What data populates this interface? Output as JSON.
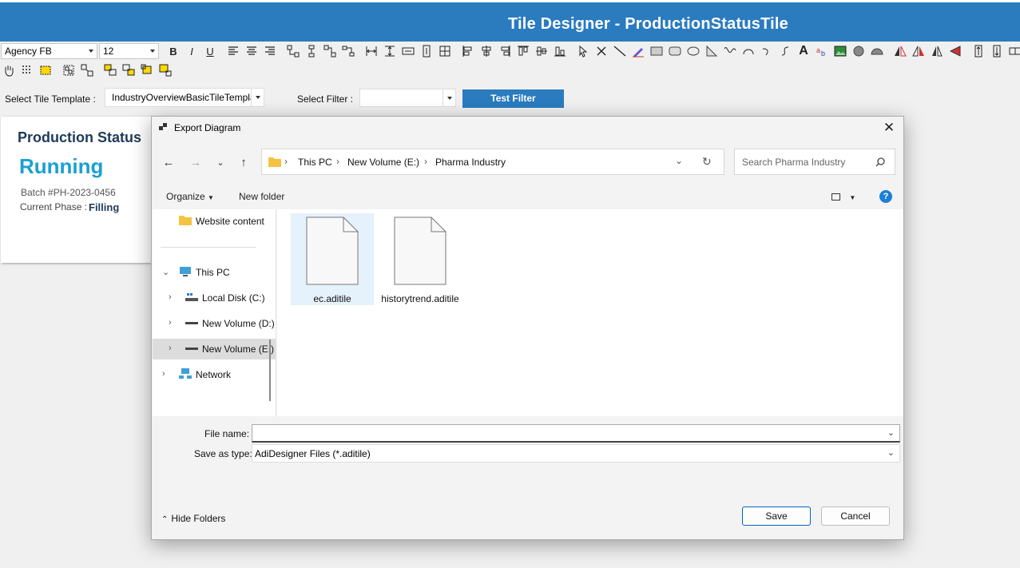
{
  "app": {
    "title": "Tile Designer - ProductionStatusTile"
  },
  "toolbar": {
    "font_family": "Agency FB",
    "font_size": "12",
    "bold_label": "B",
    "italic_label": "I",
    "underline_label": "U",
    "text_tool_label": "A"
  },
  "template_bar": {
    "template_label": "Select Tile Template :",
    "template_value": "IndustryOverviewBasicTileTemplate",
    "filter_label": "Select Filter :",
    "filter_value": "",
    "test_button": "Test Filter"
  },
  "tile": {
    "title": "Production Status",
    "status": "Running",
    "batch": "Batch #PH-2023-0456",
    "phase_label": "Current Phase :",
    "phase_value": "Filling"
  },
  "dialog": {
    "title": "Export Diagram",
    "address": [
      "This PC",
      "New Volume (E:)",
      "Pharma Industry"
    ],
    "search_placeholder": "Search Pharma Industry",
    "organize_label": "Organize",
    "new_folder_label": "New folder",
    "nav_items": [
      "Website content",
      "This PC",
      "Local Disk (C:)",
      "New Volume (D:)",
      "New Volume (E:)",
      "Network"
    ],
    "files": [
      "ec.aditile",
      "historytrend.aditile"
    ],
    "file_name_label": "File name:",
    "file_name_value": "",
    "save_type_label": "Save as type:",
    "save_type_value": "AdiDesigner Files (*.aditile)",
    "hide_folders_label": "Hide Folders",
    "save_label": "Save",
    "cancel_label": "Cancel"
  },
  "colors": {
    "accent": "#2b7bbf",
    "status": "#1aa0d0",
    "title_dark": "#1d3b5a"
  }
}
